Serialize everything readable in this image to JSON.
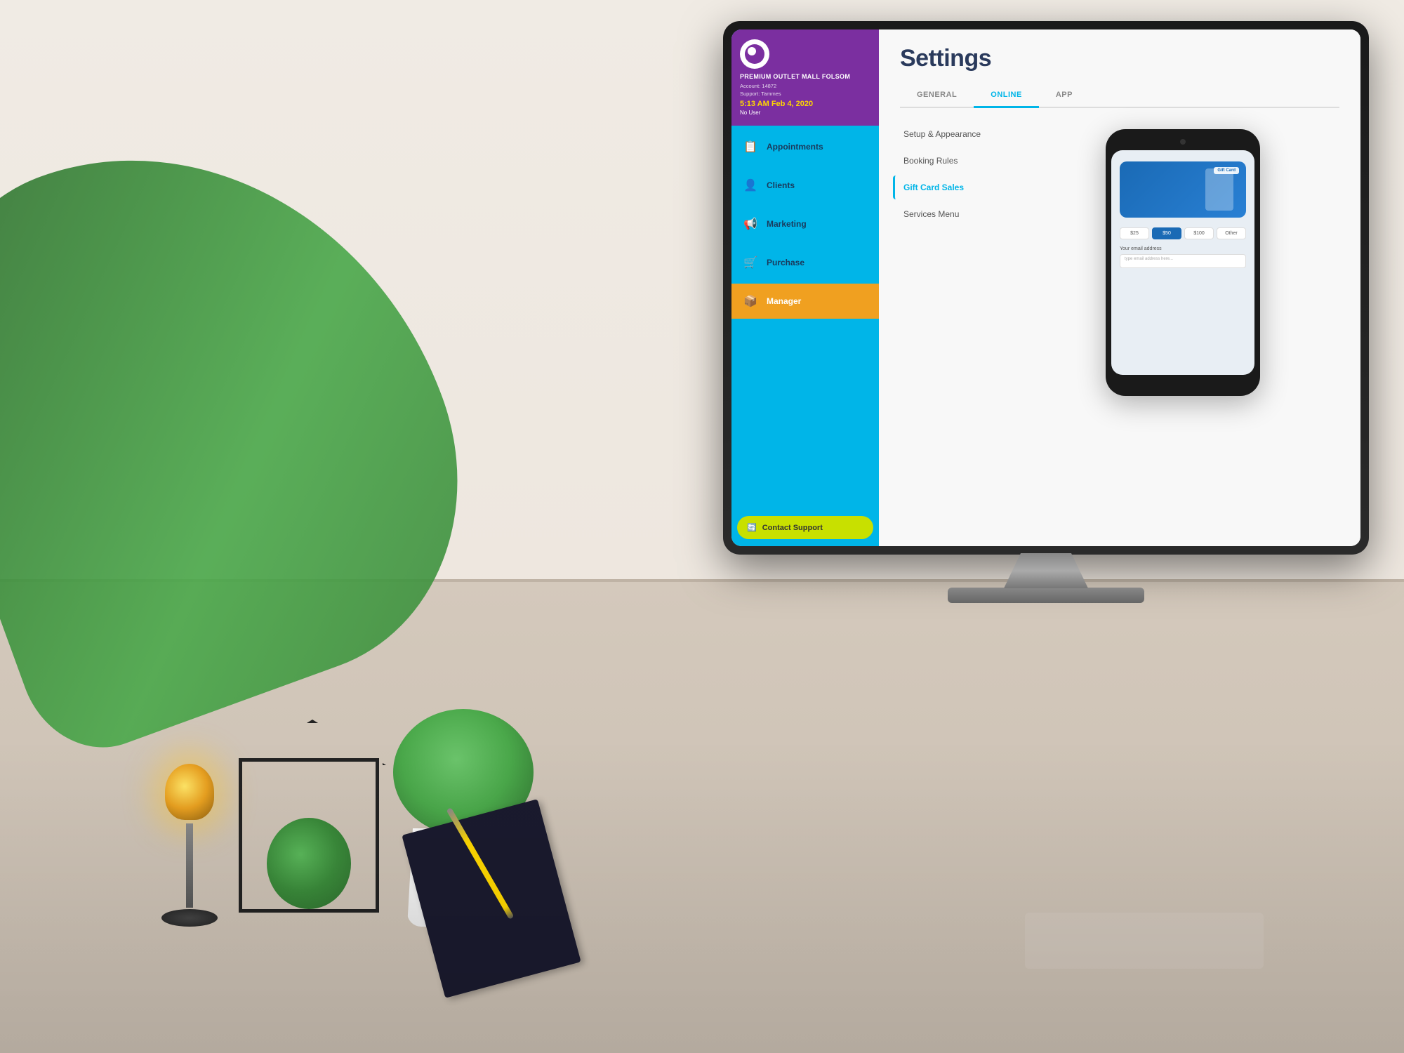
{
  "room": {
    "background": "office desk with plants and monitor"
  },
  "app": {
    "logo_alt": "Vagaro logo",
    "business_name": "PREMIUM OUTLET MALL\nFOLSOM",
    "account_label": "Account: 14872",
    "support_label": "Support: Tammes",
    "time": "5:13 AM Feb 4, 2020",
    "user": "No User"
  },
  "sidebar": {
    "items": [
      {
        "id": "appointments",
        "label": "Appointments",
        "icon": "📋"
      },
      {
        "id": "clients",
        "label": "Clients",
        "icon": "👤"
      },
      {
        "id": "marketing",
        "label": "Marketing",
        "icon": "📢"
      },
      {
        "id": "purchase",
        "label": "Purchase",
        "icon": "🛒"
      },
      {
        "id": "manager",
        "label": "Manager",
        "icon": "📦"
      }
    ],
    "contact_support_label": "Contact Support",
    "contact_support_icon": "🔄"
  },
  "settings": {
    "title": "Settings",
    "tabs": [
      {
        "id": "general",
        "label": "GENERAL"
      },
      {
        "id": "online",
        "label": "ONLINE",
        "active": true
      },
      {
        "id": "app",
        "label": "APP"
      }
    ],
    "nav_items": [
      {
        "id": "setup",
        "label": "Setup & Appearance"
      },
      {
        "id": "booking",
        "label": "Booking Rules"
      },
      {
        "id": "giftcard",
        "label": "Gift Card Sales",
        "active": true
      },
      {
        "id": "services",
        "label": "Services Menu"
      }
    ]
  },
  "phone": {
    "gift_card_label": "Gift Card",
    "amount_options": [
      "$25",
      "$50",
      "$100",
      "Other"
    ],
    "selected_amount": "$50",
    "email_label": "Your email address",
    "email_placeholder": "type email address here..."
  }
}
